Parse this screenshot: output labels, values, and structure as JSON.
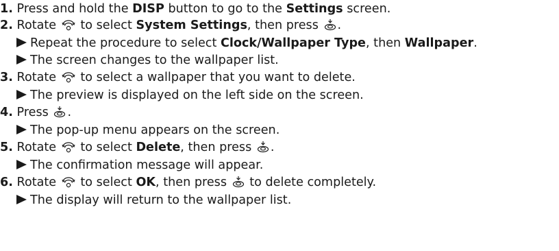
{
  "steps": [
    {
      "number": "1.",
      "parts": [
        "Press and hold the ",
        "DISP",
        " button to go to the ",
        "Settings",
        " screen."
      ]
    },
    {
      "number": "2.",
      "parts": [
        "Rotate ",
        " to select ",
        "System Settings",
        ", then press ",
        "."
      ],
      "notes": [
        {
          "parts": [
            "Repeat the procedure to select ",
            "Clock/Wallpaper Type",
            ", then ",
            "Wallpaper",
            "."
          ]
        },
        {
          "text": "The screen changes to the wallpaper list."
        }
      ]
    },
    {
      "number": "3.",
      "parts": [
        "Rotate ",
        " to select a wallpaper that you want to delete."
      ],
      "notes": [
        {
          "text": "The preview is displayed on the left side on the screen."
        }
      ]
    },
    {
      "number": "4.",
      "parts": [
        "Press ",
        "."
      ],
      "notes": [
        {
          "text": "The pop-up menu appears on the screen."
        }
      ]
    },
    {
      "number": "5.",
      "parts": [
        "Rotate ",
        " to select ",
        "Delete",
        ", then press ",
        "."
      ],
      "notes": [
        {
          "text": "The confirmation message will appear."
        }
      ]
    },
    {
      "number": "6.",
      "parts": [
        "Rotate ",
        " to select ",
        "OK",
        ", then press ",
        " to delete completely."
      ],
      "notes": [
        {
          "text": "The display will return to the wallpaper list."
        }
      ]
    }
  ],
  "icons": {
    "rotate": "interface-dial-rotate-icon",
    "press": "interface-dial-press-icon",
    "bullet": "triangle-bullet-icon"
  }
}
